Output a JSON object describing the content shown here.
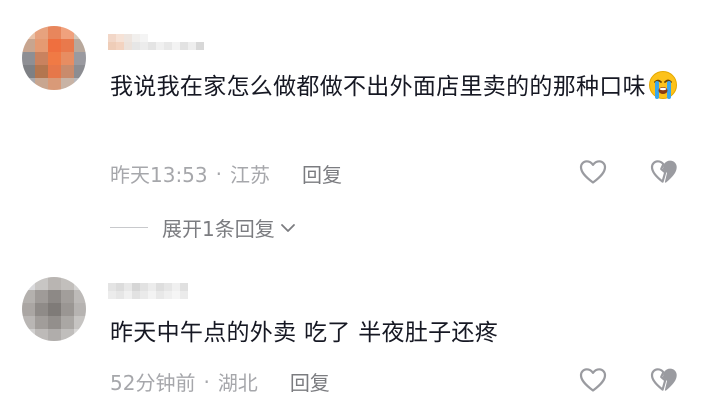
{
  "comments": [
    {
      "text": "我说我在家怎么做都做不出外面店里卖的的那种口味",
      "emoji": "loudly-crying-face",
      "time": "昨天13:53",
      "separator": "·",
      "location": "江苏",
      "reply_label": "回复",
      "expand_label": "展开1条回复"
    },
    {
      "text": "昨天中午点的外卖 吃了 半夜肚子还疼",
      "time": "52分钟前",
      "separator": "·",
      "location": "湖北",
      "reply_label": "回复"
    }
  ],
  "icons": {
    "like": "heart-outline-icon",
    "dislike": "broken-heart-icon",
    "expand": "chevron-down-icon"
  },
  "colors": {
    "text": "#161823",
    "meta": "#a6a7ab",
    "reply": "#7b7c80",
    "icon": "#9a9ba0"
  }
}
